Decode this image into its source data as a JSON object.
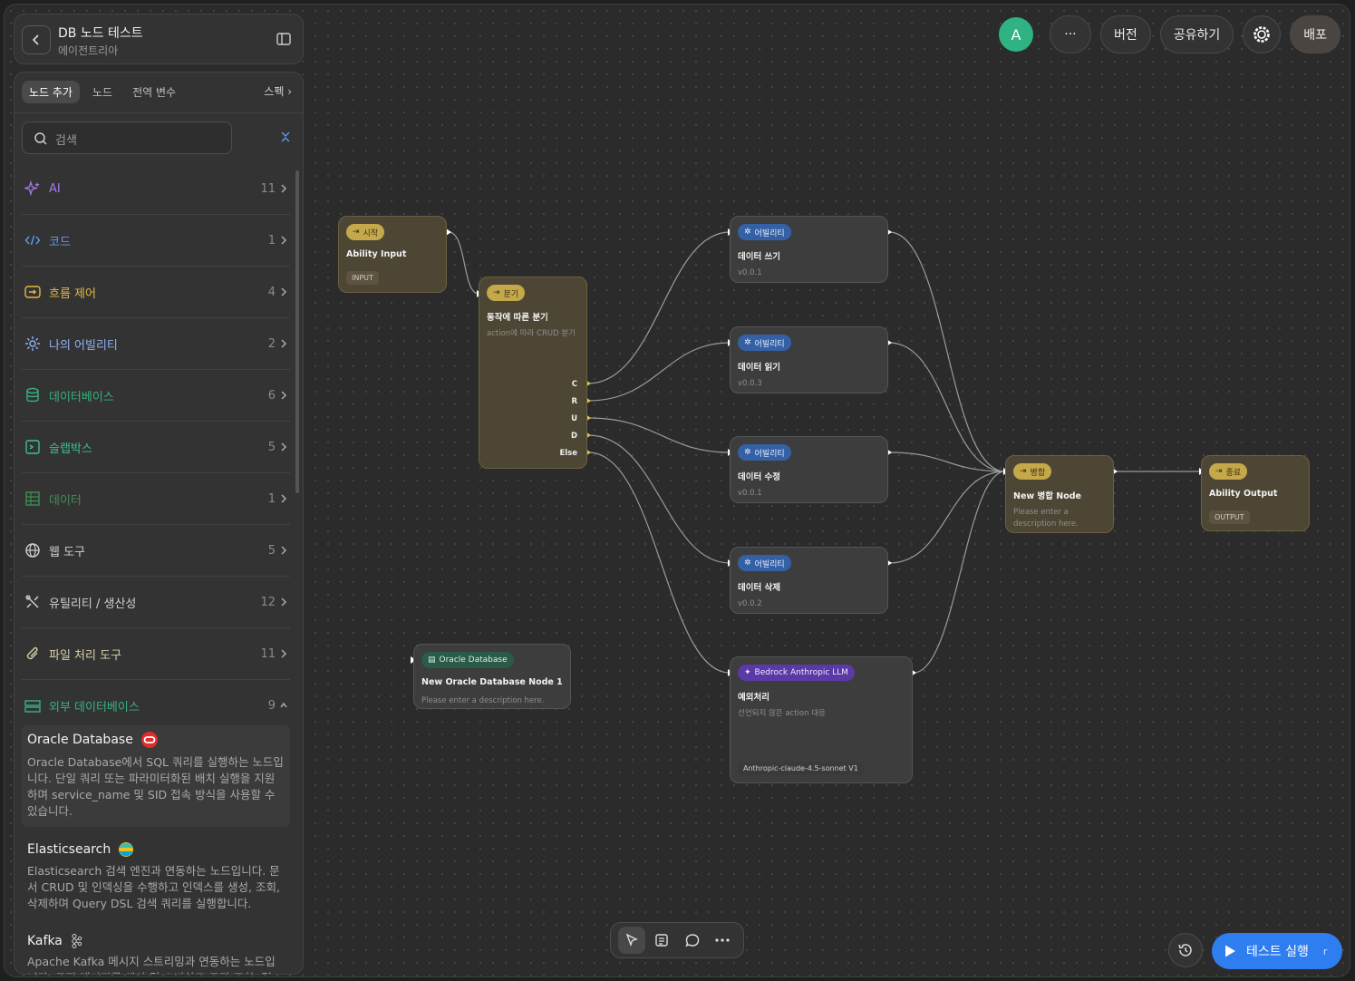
{
  "header": {
    "title": "DB 노드 테스트",
    "subtitle": "에이전트리아"
  },
  "panel": {
    "tabs": [
      "노드 추가",
      "노드",
      "전역 변수"
    ],
    "spec_label": "스펙",
    "search_placeholder": "검색",
    "categories": [
      {
        "label": "AI",
        "count": "11",
        "color": "#a879f2",
        "icon": "sparkles-icon"
      },
      {
        "label": "코드",
        "count": "1",
        "color": "#5b9cf2",
        "icon": "code-icon"
      },
      {
        "label": "흐름 제어",
        "count": "4",
        "color": "#e3b841",
        "icon": "flow-icon"
      },
      {
        "label": "나의 어빌리티",
        "count": "2",
        "color": "#8fb3f5",
        "icon": "ability-icon"
      },
      {
        "label": "데이터베이스",
        "count": "6",
        "color": "#35b27f",
        "icon": "database-icon"
      },
      {
        "label": "슬랩박스",
        "count": "5",
        "color": "#3cbf9a",
        "icon": "sandbox-icon"
      },
      {
        "label": "데이터",
        "count": "1",
        "color": "#3f8f55",
        "icon": "table-icon"
      },
      {
        "label": "웹 도구",
        "count": "5",
        "color": "#d0d0d0",
        "icon": "globe-icon"
      },
      {
        "label": "유틸리티 / 생산성",
        "count": "12",
        "color": "#d0d0d0",
        "icon": "tools-icon"
      },
      {
        "label": "파일 처리 도구",
        "count": "11",
        "color": "#d8d0a8",
        "icon": "paperclip-icon"
      },
      {
        "label": "외부 데이터베이스",
        "count": "9",
        "color": "#35b27f",
        "icon": "server-icon"
      }
    ],
    "node_items": [
      {
        "name": "Oracle Database",
        "desc": "Oracle Database에서 SQL 쿼리를 실행하는 노드입니다. 단일 쿼리 또는 파라미터화된 배치 실행을 지원하며 service_name 및 SID 접속 방식을 사용할 수 있습니다.",
        "icon": "oracle-icon"
      },
      {
        "name": "Elasticsearch",
        "desc": "Elasticsearch 검색 엔진과 연동하는 노드입니다. 문서 CRUD 및 인덱싱을 수행하고 인덱스를 생성, 조회, 삭제하며 Query DSL 검색 쿼리를 실행합니다.",
        "icon": "elasticsearch-icon"
      },
      {
        "name": "Kafka",
        "desc": "Apache Kafka 메시지 스트리밍과 연동하는 노드입니다. 토픽 메시지를 생산 및 소비하고 토픽 조회, 검사, 생",
        "icon": "kafka-icon"
      }
    ]
  },
  "topbar": {
    "avatar": "A",
    "more": "···",
    "version": "버전",
    "share": "공유하기",
    "deploy": "배포"
  },
  "nodes": {
    "start": {
      "badge": "시작",
      "title": "Ability Input",
      "tag": "INPUT"
    },
    "branch": {
      "badge": "분기",
      "title": "동작에 따른 분기",
      "sub": "action에 따라 CRUD 분기",
      "ports": [
        "C",
        "R",
        "U",
        "D",
        "Else"
      ]
    },
    "write": {
      "badge": "어빌리티",
      "title": "데이터 쓰기",
      "sub": "v0.0.1"
    },
    "read": {
      "badge": "어빌리티",
      "title": "데이터 읽기",
      "sub": "v0.0.3"
    },
    "update": {
      "badge": "어빌리티",
      "title": "데이터 수정",
      "sub": "v0.0.1"
    },
    "delete": {
      "badge": "어빌리티",
      "title": "데이터 삭제",
      "sub": "v0.0.2"
    },
    "llm": {
      "badge": "Bedrock Anthropic LLM",
      "title": "예외처리",
      "sub": "선언되지 않은 action 대응",
      "tag": "Anthropic-claude-4.5-sonnet V1"
    },
    "merge": {
      "badge": "병합",
      "title": "New 병합 Node",
      "sub": "Please enter a description here."
    },
    "end": {
      "badge": "종료",
      "title": "Ability Output",
      "tag": "OUTPUT"
    },
    "oracle": {
      "badge": "Oracle Database",
      "title": "New Oracle Database Node 1",
      "sub": "Please enter a description here."
    }
  },
  "bottom": {
    "run_label": "테스트 실행",
    "run_key": "r"
  }
}
